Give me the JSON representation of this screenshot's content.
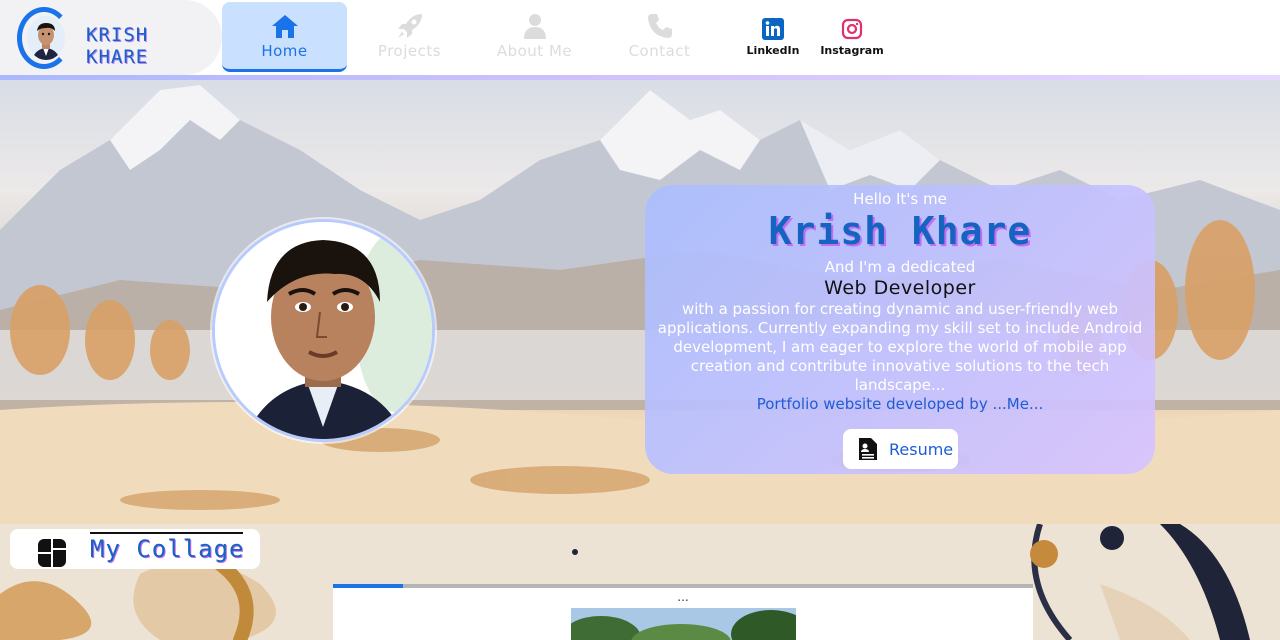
{
  "brand": {
    "name": "KRISH KHARE"
  },
  "nav": {
    "items": [
      {
        "label": "Home",
        "icon": "home-icon",
        "active": true
      },
      {
        "label": "Projects",
        "icon": "rocket-icon",
        "active": false
      },
      {
        "label": "About Me",
        "icon": "user-icon",
        "active": false
      },
      {
        "label": "Contact",
        "icon": "phone-icon",
        "active": false
      }
    ],
    "social": [
      {
        "label": "LinkedIn",
        "icon": "linkedin-icon",
        "color": "#0a66c2"
      },
      {
        "label": "Instagram",
        "icon": "instagram-icon",
        "color": "#e1306c"
      }
    ]
  },
  "hero": {
    "greeting": "Hello It's me",
    "name": "Krish Khare",
    "dedicated": "And I'm a dedicated",
    "role": "Web Developer",
    "bio": "with a passion for creating dynamic and user-friendly web applications. Currently expanding my skill set to include Android development, I am eager to explore the world of mobile app creation and contribute innovative solutions to the tech landscape...",
    "credit": "Portfolio website developed by ...Me...",
    "resume_label": "Resume"
  },
  "collage": {
    "title": "My Collage",
    "caption": "...",
    "progress_fraction": 0.1
  },
  "colors": {
    "accent": "#1a73e8",
    "nav_active_bg": "#c9e0ff",
    "card_gradient_start": "#aabeff",
    "card_gradient_end": "#d7c3ff"
  }
}
